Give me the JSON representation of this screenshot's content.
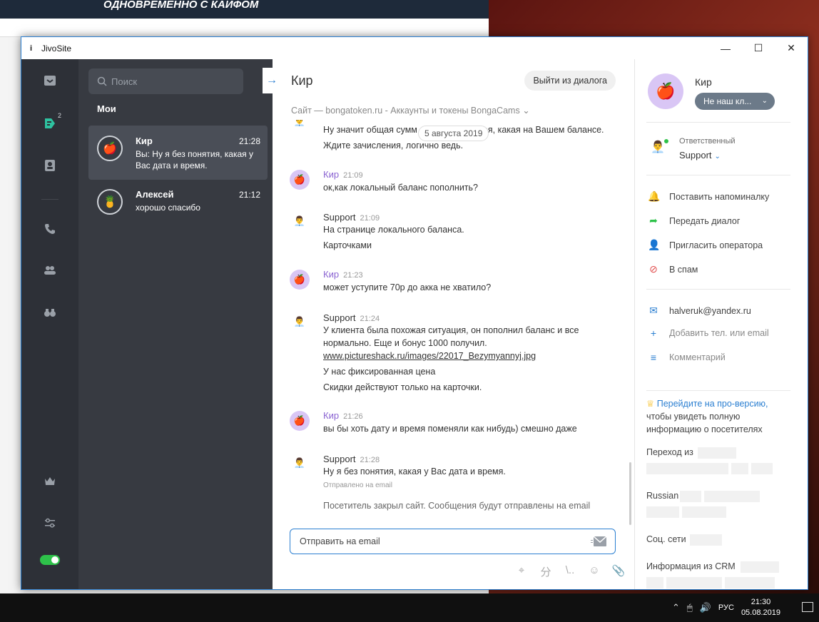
{
  "desktop": {
    "banner": "ОДНОВРЕМЕННО С КАЙФОМ",
    "clock_time": "21:30",
    "clock_date": "05.08.2019",
    "lang": "РУС"
  },
  "window": {
    "title": "JivoSite"
  },
  "chatlist": {
    "search_placeholder": "Поиск",
    "heading": "Мои",
    "items": [
      {
        "name": "Кир",
        "time": "21:28",
        "preview": "Вы: Ну я без понятия, какая у Вас дата и время."
      },
      {
        "name": "Алексей",
        "time": "21:12",
        "preview": "хорошо спасибо"
      }
    ]
  },
  "chat": {
    "title": "Кир",
    "leave_label": "Выйти из диалога",
    "site_line": "Сайт — bongatoken.ru - Аккаунты и токены BongaCams",
    "date_pill": "5 августа 2019",
    "partial_lines": [
      "Ну значит общая сумм",
      "ая, какая на Вашем балансе.",
      "Ждите зачисления, логично ведь."
    ],
    "messages": [
      {
        "author": "Кир",
        "time": "21:09",
        "lines": [
          "ок,как локальный баланс пополнить?"
        ]
      },
      {
        "author": "Support",
        "time": "21:09",
        "lines": [
          "На странице локального баланса.",
          "Карточками"
        ]
      },
      {
        "author": "Кир",
        "time": "21:23",
        "lines": [
          "может уступите 70р до акка не хватило?"
        ]
      },
      {
        "author": "Support",
        "time": "21:24",
        "lines": [
          "У клиента была похожая ситуация, он пополнил баланс и все",
          "нормально. Еще и бонус 1000 получил.",
          "www.pictureshack.ru/images/22017_Bezymyannyj.jpg",
          "У нас фиксированная цена",
          "Скидки действуют только на карточки."
        ]
      },
      {
        "author": "Кир",
        "time": "21:26",
        "lines": [
          "вы бы хоть дату и время поменяли как нибудь) смешно даже"
        ]
      },
      {
        "author": "Support",
        "time": "21:28",
        "lines": [
          "Ну я без понятия, какая у Вас дата и время."
        ],
        "note": "Отправлено на email"
      }
    ],
    "system_note": "Посетитель закрыл сайт. Сообщения будут отправлены на email",
    "composer_text": "Отправить на email"
  },
  "side": {
    "name": "Кир",
    "tag": "Не наш кл...",
    "responsible_label": "Ответственный",
    "responsible_value": "Support",
    "actions": [
      "Поставить напоминалку",
      "Передать диалог",
      "Пригласить оператора",
      "В спам"
    ],
    "email": "halveruk@yandex.ru",
    "add_contact": "Добавить тел. или email",
    "comment": "Комментарий",
    "pro_link": "Перейдите на про-версию,",
    "pro_rest": "чтобы увидеть полную информацию о посетителях",
    "info_labels": [
      "Переход из",
      "Russian",
      "Соц. сети",
      "Информация из CRM"
    ]
  },
  "colors": {
    "accent": "#2b7fd1",
    "rail": "#2d3037",
    "list": "#373a41",
    "client": "#8a63d2",
    "online": "#2ec24a"
  }
}
